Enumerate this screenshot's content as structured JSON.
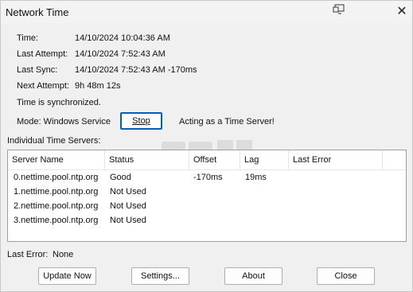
{
  "window": {
    "title": "Network Time",
    "close_glyph": "✕",
    "title_icon": "window-monitor-icon"
  },
  "status": {
    "time_label": "Time:",
    "time_value": "14/10/2024 10:04:36 AM",
    "last_attempt_label": "Last Attempt:",
    "last_attempt_value": "14/10/2024 7:52:43 AM",
    "last_sync_label": "Last Sync:",
    "last_sync_value": "14/10/2024 7:52:43 AM -170ms",
    "next_attempt_label": "Next Attempt:",
    "next_attempt_value": "9h 48m 12s",
    "sync_message": "Time is synchronized."
  },
  "mode": {
    "text": "Mode: Windows Service",
    "stop_button": "Stop",
    "server_text": "Acting as a Time Server!"
  },
  "servers": {
    "group_label": "Individual Time Servers:",
    "columns": [
      "Server Name",
      "Status",
      "Offset",
      "Lag",
      "Last Error"
    ],
    "rows": [
      {
        "name": "0.nettime.pool.ntp.org",
        "status": "Good",
        "offset": "-170ms",
        "lag": "19ms",
        "last_error": ""
      },
      {
        "name": "1.nettime.pool.ntp.org",
        "status": "Not Used",
        "offset": "",
        "lag": "",
        "last_error": ""
      },
      {
        "name": "2.nettime.pool.ntp.org",
        "status": "Not Used",
        "offset": "",
        "lag": "",
        "last_error": ""
      },
      {
        "name": "3.nettime.pool.ntp.org",
        "status": "Not Used",
        "offset": "",
        "lag": "",
        "last_error": ""
      }
    ]
  },
  "footer": {
    "last_error_label": "Last Error:",
    "last_error_value": "None",
    "update_now": "Update Now",
    "settings": "Settings...",
    "about": "About",
    "close": "Close"
  },
  "colors": {
    "background": "#f0f0f0",
    "default_button_border": "#005fb8"
  }
}
